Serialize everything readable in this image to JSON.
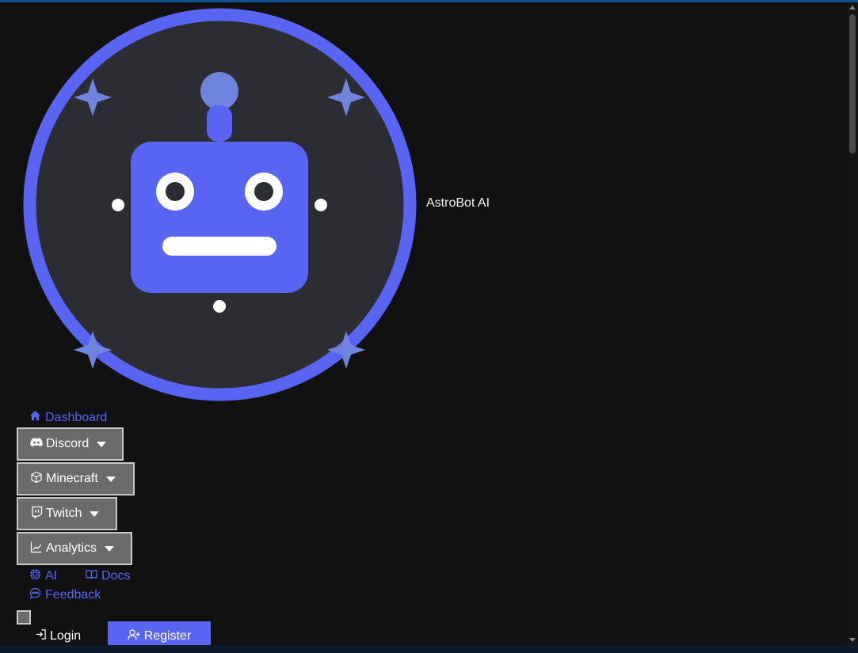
{
  "brand": {
    "name": "AstroBot AI",
    "logo_icon": "robot-logo-icon"
  },
  "nav": {
    "dashboard": {
      "label": "Dashboard",
      "icon": "home-icon"
    },
    "dropdowns": [
      {
        "label": "Discord",
        "icon": "discord-icon"
      },
      {
        "label": "Minecraft",
        "icon": "cube-icon"
      },
      {
        "label": "Twitch",
        "icon": "twitch-icon"
      },
      {
        "label": "Analytics",
        "icon": "chart-line-icon"
      }
    ],
    "ai": {
      "label": "AI",
      "icon": "chip-icon"
    },
    "docs": {
      "label": "Docs",
      "icon": "book-icon"
    },
    "feedback": {
      "label": "Feedback",
      "icon": "chat-icon"
    }
  },
  "auth": {
    "login_label": "Login",
    "register_label": "Register"
  },
  "colors": {
    "accent": "#5865f2",
    "background": "#111112",
    "button_gray": "#6b6b6b"
  }
}
